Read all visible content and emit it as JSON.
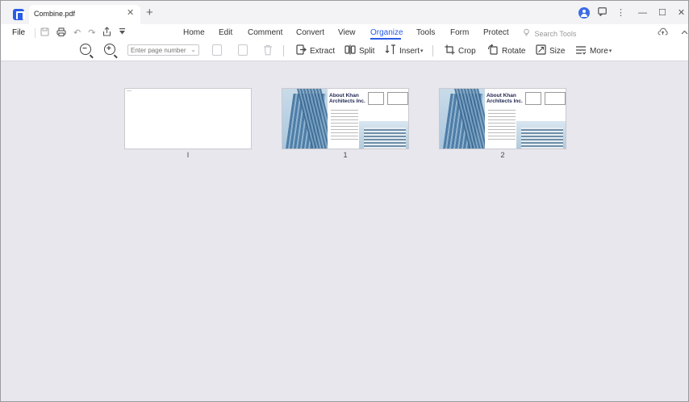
{
  "window": {
    "tab_title": "Combine.pdf",
    "tab_close_glyph": "✕",
    "tab_add_glyph": "+",
    "icons": [
      "app-logo-icon",
      "account-icon",
      "chat-icon",
      "more-vertical-icon"
    ],
    "controls": {
      "minimize": "—",
      "maximize": "☐",
      "close": "✕"
    }
  },
  "menubar": {
    "file_label": "File",
    "items": [
      {
        "label": "Home",
        "active": false
      },
      {
        "label": "Edit",
        "active": false
      },
      {
        "label": "Comment",
        "active": false
      },
      {
        "label": "Convert",
        "active": false
      },
      {
        "label": "View",
        "active": false
      },
      {
        "label": "Organize",
        "active": true
      },
      {
        "label": "Tools",
        "active": false
      },
      {
        "label": "Form",
        "active": false
      },
      {
        "label": "Protect",
        "active": false
      }
    ],
    "search_placeholder": "Search Tools",
    "accent_color": "#2a5ce6"
  },
  "toolbar": {
    "page_number_placeholder": "Enter page number",
    "tools": {
      "extract": "Extract",
      "split": "Split",
      "insert": "Insert",
      "crop": "Crop",
      "rotate": "Rotate",
      "size": "Size",
      "more": "More"
    }
  },
  "pages": [
    {
      "label": "I",
      "kind": "blank"
    },
    {
      "label": "1",
      "kind": "brochure",
      "title": "About Khan Architects Inc."
    },
    {
      "label": "2",
      "kind": "brochure",
      "title": "About Khan Architects Inc."
    }
  ]
}
